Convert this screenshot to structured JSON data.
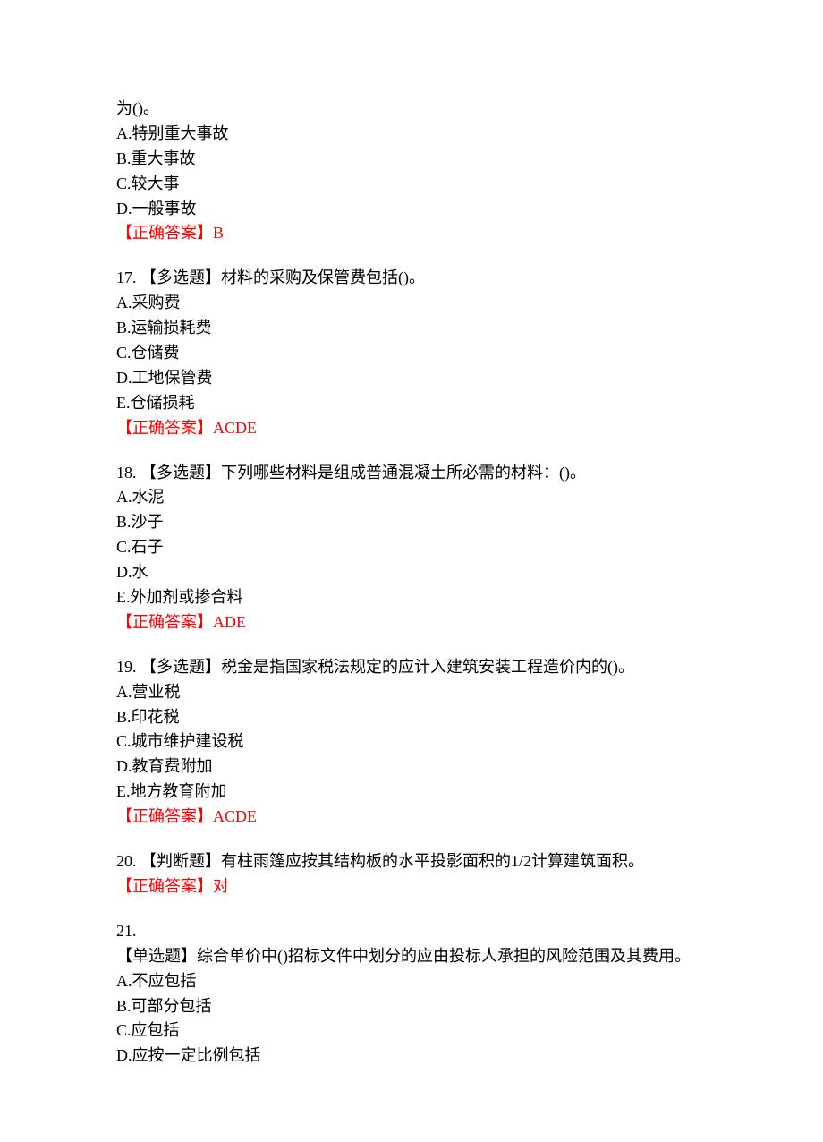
{
  "q16": {
    "stem_cont": "为()。",
    "opts": {
      "A": "A.特别重大事故",
      "B": "B.重大事故",
      "C": "C.较大事",
      "D": "D.一般事故"
    },
    "answer_label": "【正确答案】",
    "answer_value": "B"
  },
  "q17": {
    "stem": "17. 【多选题】材料的采购及保管费包括()。",
    "opts": {
      "A": "A.采购费",
      "B": "B.运输损耗费",
      "C": "C.仓储费",
      "D": "D.工地保管费",
      "E": "E.仓储损耗"
    },
    "answer_label": "【正确答案】",
    "answer_value": "ACDE"
  },
  "q18": {
    "stem": "18. 【多选题】下列哪些材料是组成普通混凝土所必需的材料：()。",
    "opts": {
      "A": "A.水泥",
      "B": "B.沙子",
      "C": "C.石子",
      "D": "D.水",
      "E": "E.外加剂或掺合料"
    },
    "answer_label": "【正确答案】",
    "answer_value": "ADE"
  },
  "q19": {
    "stem": "19. 【多选题】税金是指国家税法规定的应计入建筑安装工程造价内的()。",
    "opts": {
      "A": "A.营业税",
      "B": "B.印花税",
      "C": "C.城市维护建设税",
      "D": "D.教育费附加",
      "E": "E.地方教育附加"
    },
    "answer_label": "【正确答案】",
    "answer_value": "ACDE"
  },
  "q20": {
    "stem": "20. 【判断题】有柱雨篷应按其结构板的水平投影面积的1/2计算建筑面积。",
    "answer_label": "【正确答案】",
    "answer_value": "对"
  },
  "q21": {
    "num": "21.",
    "stem": "【单选题】综合单价中()招标文件中划分的应由投标人承担的风险范围及其费用。",
    "opts": {
      "A": "A.不应包括",
      "B": "B.可部分包括",
      "C": "C.应包括",
      "D": "D.应按一定比例包括"
    }
  }
}
